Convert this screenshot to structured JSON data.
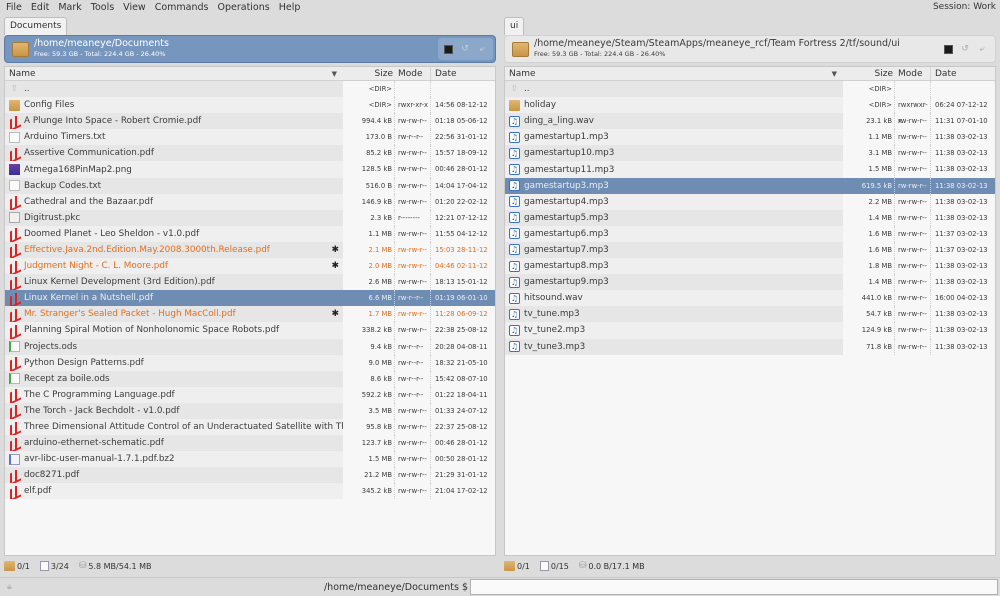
{
  "menu": [
    "File",
    "Edit",
    "Mark",
    "Tools",
    "View",
    "Commands",
    "Operations",
    "Help"
  ],
  "session": "Session: Work",
  "columns": {
    "name": "Name",
    "size": "Size",
    "mode": "Mode",
    "date": "Date"
  },
  "left": {
    "tab": "Documents",
    "path": "/home/meaneye/Documents",
    "free": "Free: 59.3 GB - Total: 224.4 GB - 26.40%",
    "rows": [
      {
        "name": "..",
        "icon": "up",
        "size": "<DIR>",
        "mode": "",
        "date": ""
      },
      {
        "name": "Config Files",
        "icon": "folder",
        "size": "<DIR>",
        "mode": "rwxr-xr-x",
        "date": "14:56 08-12-12"
      },
      {
        "name": "A Plunge Into Space - Robert Cromie.pdf",
        "icon": "pdf",
        "size": "994.4 kB",
        "mode": "rw-rw-r--",
        "date": "01:18 05-06-12"
      },
      {
        "name": "Arduino Timers.txt",
        "icon": "txt",
        "size": "173.0 B",
        "mode": "rw-r--r--",
        "date": "22:56 31-01-12"
      },
      {
        "name": "Assertive Communication.pdf",
        "icon": "pdf",
        "size": "85.2 kB",
        "mode": "rw-rw-r--",
        "date": "15:57 18-09-12"
      },
      {
        "name": "Atmega168PinMap2.png",
        "icon": "png",
        "size": "128.5 kB",
        "mode": "rw-rw-r--",
        "date": "00:46 28-01-12"
      },
      {
        "name": "Backup Codes.txt",
        "icon": "txt",
        "size": "516.0 B",
        "mode": "rw-rw-r--",
        "date": "14:04 17-04-12"
      },
      {
        "name": "Cathedral and the Bazaar.pdf",
        "icon": "pdf",
        "size": "146.9 kB",
        "mode": "rw-rw-r--",
        "date": "01:20 22-02-12"
      },
      {
        "name": "Digitrust.pkc",
        "icon": "pkc",
        "size": "2.3 kB",
        "mode": "r--------",
        "date": "12:21 07-12-12"
      },
      {
        "name": "Doomed Planet - Leo Sheldon - v1.0.pdf",
        "icon": "pdf",
        "size": "1.1 MB",
        "mode": "rw-rw-r--",
        "date": "11:55 04-12-12"
      },
      {
        "name": "Effective.Java.2nd.Edition.May.2008.3000th.Release.pdf",
        "icon": "pdf",
        "size": "2.1 MB",
        "mode": "rw-rw-r--",
        "date": "15:03 28-11-12",
        "marked": true
      },
      {
        "name": "Judgment Night - C. L. Moore.pdf",
        "icon": "pdf",
        "size": "2.0 MB",
        "mode": "rw-rw-r--",
        "date": "04:46 02-11-12",
        "marked": true
      },
      {
        "name": "Linux Kernel Development (3rd Edition).pdf",
        "icon": "pdf",
        "size": "2.6 MB",
        "mode": "rw-rw-r--",
        "date": "18:13 15-01-12"
      },
      {
        "name": "Linux Kernel in a Nutshell.pdf",
        "icon": "pdf",
        "size": "6.6 MB",
        "mode": "rw-r--r--",
        "date": "01:19 06-01-10",
        "selected": true
      },
      {
        "name": "Mr. Stranger's Sealed Packet - Hugh MacColl.pdf",
        "icon": "pdf",
        "size": "1.7 MB",
        "mode": "rw-rw-r--",
        "date": "11:28 06-09-12",
        "marked": true
      },
      {
        "name": "Planning Spiral Motion of Nonholonomic Space Robots.pdf",
        "icon": "pdf",
        "size": "338.2 kB",
        "mode": "rw-rw-r--",
        "date": "22:38 25-08-12"
      },
      {
        "name": "Projects.ods",
        "icon": "ods",
        "size": "9.4 kB",
        "mode": "rw-r--r--",
        "date": "20:28 04-08-11"
      },
      {
        "name": "Python Design Patterns.pdf",
        "icon": "pdf",
        "size": "9.0 MB",
        "mode": "rw-r--r--",
        "date": "18:32 21-05-10"
      },
      {
        "name": "Recept za boile.ods",
        "icon": "ods",
        "size": "8.6 kB",
        "mode": "rw-r--r--",
        "date": "15:42 08-07-10"
      },
      {
        "name": "The C Programming Language.pdf",
        "icon": "pdf",
        "size": "592.2 kB",
        "mode": "rw-r--r--",
        "date": "01:22 18-04-11"
      },
      {
        "name": "The Torch - Jack Bechdolt - v1.0.pdf",
        "icon": "pdf",
        "size": "3.5 MB",
        "mode": "rw-rw-r--",
        "date": "01:33 24-07-12"
      },
      {
        "name": "Three Dimensional Attitude Control of an Underactuated Satellite with Thru",
        "icon": "pdf",
        "size": "95.8 kB",
        "mode": "rw-rw-r--",
        "date": "22:37 25-08-12"
      },
      {
        "name": "arduino-ethernet-schematic.pdf",
        "icon": "pdf",
        "size": "123.7 kB",
        "mode": "rw-rw-r--",
        "date": "00:46 28-01-12"
      },
      {
        "name": "avr-libc-user-manual-1.7.1.pdf.bz2",
        "icon": "bz2",
        "size": "1.5 MB",
        "mode": "rw-rw-r--",
        "date": "00:50 28-01-12"
      },
      {
        "name": "doc8271.pdf",
        "icon": "pdf",
        "size": "21.2 MB",
        "mode": "rw-rw-r--",
        "date": "21:29 31-01-12"
      },
      {
        "name": "elf.pdf",
        "icon": "pdf",
        "size": "345.2 kB",
        "mode": "rw-rw-r--",
        "date": "21:04 17-02-12"
      }
    ],
    "status": {
      "dirs": "0/1",
      "files": "3/24",
      "size": "5.8 MB/54.1 MB"
    }
  },
  "right": {
    "tab": "ui",
    "path": "/home/meaneye/Steam/SteamApps/meaneye_rcf/Team Fortress 2/tf/sound/ui",
    "free": "Free: 59.3 GB - Total: 224.4 GB - 26.40%",
    "rows": [
      {
        "name": "..",
        "icon": "up",
        "size": "<DIR>",
        "mode": "",
        "date": ""
      },
      {
        "name": "holiday",
        "icon": "folder",
        "size": "<DIR>",
        "mode": "rwxrwxr-x",
        "date": "06:24 07-12-12"
      },
      {
        "name": "ding_a_ling.wav",
        "icon": "audio",
        "size": "23.1 kB",
        "mode": "rw-rw-r--",
        "date": "11:31 07-01-10"
      },
      {
        "name": "gamestartup1.mp3",
        "icon": "audio",
        "size": "1.1 MB",
        "mode": "rw-rw-r--",
        "date": "11:38 03-02-13"
      },
      {
        "name": "gamestartup10.mp3",
        "icon": "audio",
        "size": "3.1 MB",
        "mode": "rw-rw-r--",
        "date": "11:38 03-02-13"
      },
      {
        "name": "gamestartup11.mp3",
        "icon": "audio",
        "size": "1.5 MB",
        "mode": "rw-rw-r--",
        "date": "11:38 03-02-13"
      },
      {
        "name": "gamestartup3.mp3",
        "icon": "audio",
        "size": "619.5 kB",
        "mode": "rw-rw-r--",
        "date": "11:38 03-02-13",
        "selected": true
      },
      {
        "name": "gamestartup4.mp3",
        "icon": "audio",
        "size": "2.2 MB",
        "mode": "rw-rw-r--",
        "date": "11:38 03-02-13"
      },
      {
        "name": "gamestartup5.mp3",
        "icon": "audio",
        "size": "1.4 MB",
        "mode": "rw-rw-r--",
        "date": "11:38 03-02-13"
      },
      {
        "name": "gamestartup6.mp3",
        "icon": "audio",
        "size": "1.6 MB",
        "mode": "rw-rw-r--",
        "date": "11:37 03-02-13"
      },
      {
        "name": "gamestartup7.mp3",
        "icon": "audio",
        "size": "1.6 MB",
        "mode": "rw-rw-r--",
        "date": "11:37 03-02-13"
      },
      {
        "name": "gamestartup8.mp3",
        "icon": "audio",
        "size": "1.8 MB",
        "mode": "rw-rw-r--",
        "date": "11:38 03-02-13"
      },
      {
        "name": "gamestartup9.mp3",
        "icon": "audio",
        "size": "1.4 MB",
        "mode": "rw-rw-r--",
        "date": "11:38 03-02-13"
      },
      {
        "name": "hitsound.wav",
        "icon": "audio",
        "size": "441.0 kB",
        "mode": "rw-rw-r--",
        "date": "16:00 04-02-13"
      },
      {
        "name": "tv_tune.mp3",
        "icon": "audio",
        "size": "54.7 kB",
        "mode": "rw-rw-r--",
        "date": "11:38 03-02-13"
      },
      {
        "name": "tv_tune2.mp3",
        "icon": "audio",
        "size": "124.9 kB",
        "mode": "rw-rw-r--",
        "date": "11:38 03-02-13"
      },
      {
        "name": "tv_tune3.mp3",
        "icon": "audio",
        "size": "71.8 kB",
        "mode": "rw-rw-r--",
        "date": "11:38 03-02-13"
      }
    ],
    "status": {
      "dirs": "0/1",
      "files": "0/15",
      "size": "0.0 B/17.1 MB"
    }
  },
  "command": {
    "prompt": "/home/meaneye/Documents $",
    "value": ""
  },
  "colors": {
    "selection": "#6f8db3",
    "marked": "#e2701d",
    "active_path": "#7796bd"
  }
}
